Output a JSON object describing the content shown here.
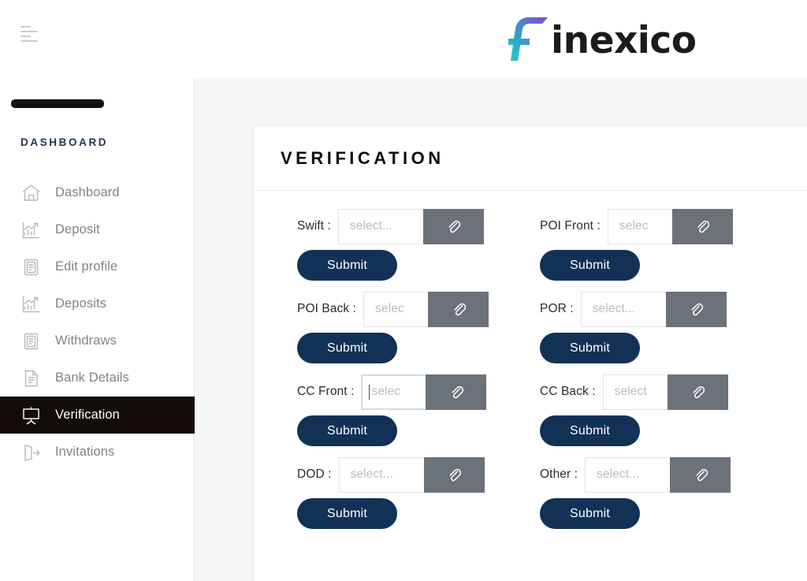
{
  "brand": {
    "mark": "finexico-f-logo",
    "word": "inexico",
    "full_name": "finexico",
    "colors": {
      "gradient_start": "#8b3fd6",
      "gradient_mid": "#3c86c6",
      "gradient_end": "#2fc0c6"
    }
  },
  "topbar": {
    "menu_icon": "hamburger-menu-icon"
  },
  "sidebar": {
    "user_name": "[redacted]",
    "section_title": "DASHBOARD",
    "items": [
      {
        "label": "Dashboard",
        "icon": "home-icon",
        "active": false
      },
      {
        "label": "Deposit",
        "icon": "bar-chart-icon",
        "active": false
      },
      {
        "label": "Edit profile",
        "icon": "clipboard-icon",
        "active": false
      },
      {
        "label": "Deposits",
        "icon": "bar-chart-icon",
        "active": false
      },
      {
        "label": "Withdraws",
        "icon": "clipboard-icon",
        "active": false
      },
      {
        "label": "Bank Details",
        "icon": "document-icon",
        "active": false
      },
      {
        "label": "Verification",
        "icon": "presentation-icon",
        "active": true
      },
      {
        "label": "Invitations",
        "icon": "exit-door-icon",
        "active": false
      }
    ],
    "active_item": "Verification"
  },
  "card": {
    "title": "VERIFICATION",
    "submit_label": "Submit",
    "attach_icon": "paperclip-icon",
    "fields": [
      {
        "label": "Swift :",
        "placeholder": "select...",
        "value": "",
        "input_width": 108,
        "focused": false
      },
      {
        "label": "POI Front :",
        "placeholder": "selec",
        "value": "",
        "input_width": 82,
        "focused": false
      },
      {
        "label": "POI Back :",
        "placeholder": "selec",
        "value": "",
        "input_width": 82,
        "focused": false
      },
      {
        "label": "POR :",
        "placeholder": "select...",
        "value": "",
        "input_width": 108,
        "focused": false
      },
      {
        "label": "CC Front :",
        "placeholder": "selec",
        "value": "",
        "input_width": 82,
        "focused": true
      },
      {
        "label": "CC Back :",
        "placeholder": "select",
        "value": "",
        "input_width": 82,
        "focused": false
      },
      {
        "label": "DOD :",
        "placeholder": "select...",
        "value": "",
        "input_width": 108,
        "focused": false
      },
      {
        "label": "Other :",
        "placeholder": "select...",
        "value": "",
        "input_width": 108,
        "focused": false
      }
    ]
  },
  "colors": {
    "page_background": "#f4f6f8",
    "card_background": "#ffffff",
    "submit_navy": "#113156",
    "attach_gray": "#6c727a",
    "active_nav": "#140b0b",
    "section_title": "#1f3551",
    "focus_border": "#cfdcf0"
  }
}
